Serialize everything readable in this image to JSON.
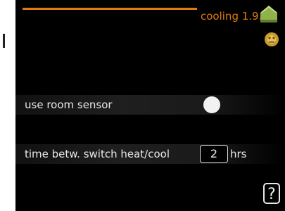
{
  "header": {
    "title": "cooling 1.9.5",
    "accent_color": "#e07a10",
    "house_icon": "house-icon",
    "sensor_icon": "sensor-icon"
  },
  "settings": [
    {
      "label": "use room sensor",
      "control": "toggle",
      "state": "on"
    },
    {
      "label": "time betw. switch heat/cool",
      "control": "number",
      "value": "2",
      "unit": "hrs"
    }
  ],
  "help": {
    "label": "?"
  }
}
